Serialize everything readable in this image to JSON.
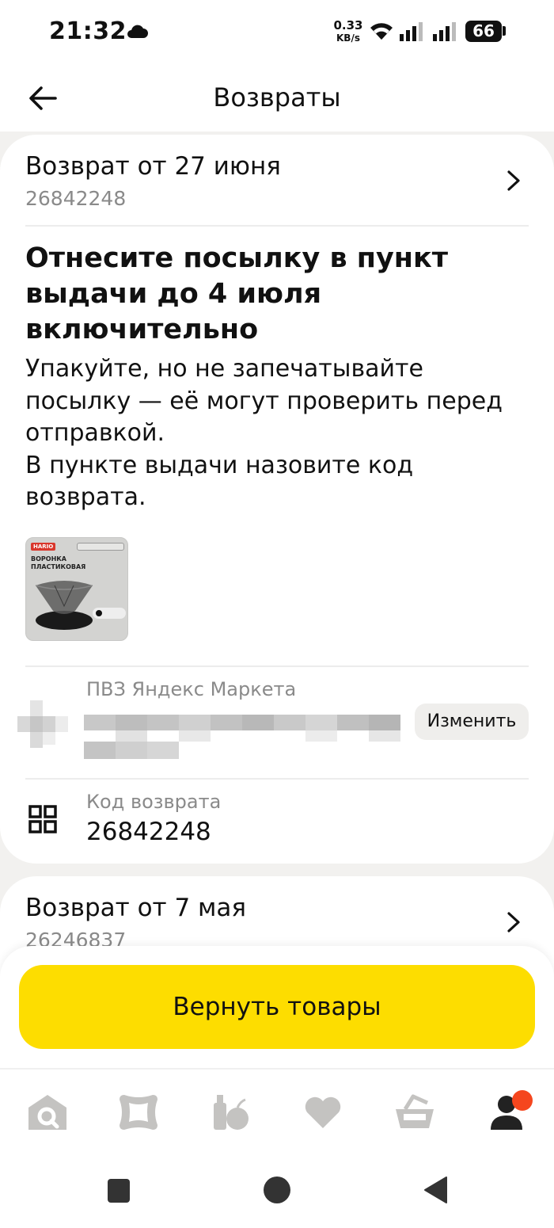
{
  "status_bar": {
    "time": "21:32",
    "net_speed": "0.33",
    "net_unit": "KB/s",
    "battery": "66",
    "icons": [
      "cloud-icon",
      "wifi-icon",
      "signal-icon",
      "signal-icon",
      "battery-icon"
    ]
  },
  "header": {
    "title": "Возвраты",
    "back_icon": "arrow-left-icon"
  },
  "returns": [
    {
      "title": "Возврат от 27 июня",
      "number": "26842248",
      "heading": "Отнесите посылку в пункт выдачи до 4 июля включительно",
      "description_lines": [
        "Упакуйте, но не запечатывайте",
        "посылку — её могут проверить перед",
        "отправкой.",
        "В пункте выдачи назовите код",
        "возврата."
      ],
      "product": {
        "brand": "HARIO",
        "name": "ВОРОНКА ПЛАСТИКОВАЯ"
      },
      "pickup": {
        "label": "ПВЗ Яндекс Маркета",
        "change_label": "Изменить"
      },
      "code": {
        "label": "Код возврата",
        "value": "26842248"
      }
    },
    {
      "title": "Возврат от 7 мая",
      "number": "26246837"
    }
  ],
  "primary_action": "Вернуть товары",
  "tabbar": {
    "items": [
      "home-icon",
      "catalog-icon",
      "groceries-icon",
      "favorites-icon",
      "cart-icon",
      "profile-icon"
    ],
    "inactive_color": "#c4c3c1",
    "active_color": "#222222",
    "badge_color": "#f5461e"
  },
  "colors": {
    "accent": "#fddd00",
    "background": "#f2f1ef"
  }
}
